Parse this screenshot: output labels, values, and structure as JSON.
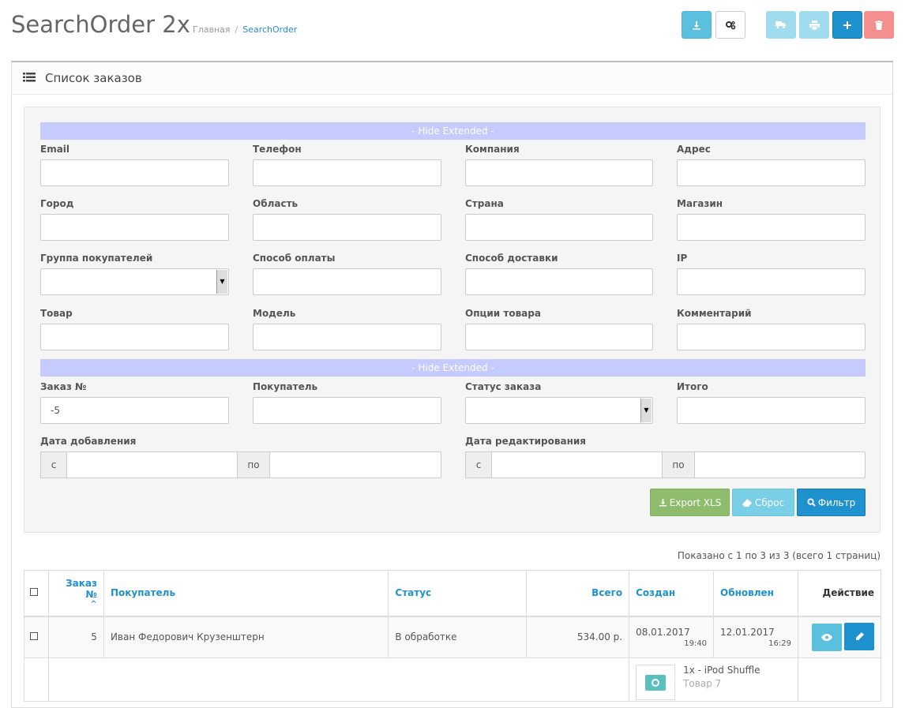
{
  "header": {
    "title": "SearchOrder 2x",
    "breadcrumb": [
      "Главная",
      "SearchOrder"
    ],
    "breadcrumb_sep": "/",
    "toolbar": {
      "download_icon": "download-icon",
      "settings_icon": "cogs-icon",
      "shipping_icon": "truck-icon",
      "print_icon": "print-icon",
      "add_icon": "plus-icon",
      "delete_icon": "trash-icon"
    }
  },
  "panel": {
    "title": "Список заказов",
    "title_icon": "list-icon"
  },
  "filters": {
    "extended_toggle_1": "- Hide Extended -",
    "extended_toggle_2": "- Hide Extended -",
    "fields": {
      "email": {
        "label": "Email",
        "value": ""
      },
      "phone": {
        "label": "Телефон",
        "value": ""
      },
      "company": {
        "label": "Компания",
        "value": ""
      },
      "address": {
        "label": "Адрес",
        "value": ""
      },
      "city": {
        "label": "Город",
        "value": ""
      },
      "region": {
        "label": "Область",
        "value": ""
      },
      "country": {
        "label": "Страна",
        "value": ""
      },
      "store": {
        "label": "Магазин",
        "value": ""
      },
      "customer_group": {
        "label": "Группа покупателей",
        "value": ""
      },
      "payment_method": {
        "label": "Способ оплаты",
        "value": ""
      },
      "shipping_method": {
        "label": "Способ доставки",
        "value": ""
      },
      "ip": {
        "label": "IP",
        "value": ""
      },
      "product": {
        "label": "Товар",
        "value": ""
      },
      "model": {
        "label": "Модель",
        "value": ""
      },
      "product_options": {
        "label": "Опции товара",
        "value": ""
      },
      "comment": {
        "label": "Комментарий",
        "value": ""
      },
      "order_id": {
        "label": "Заказ №",
        "value": "-5"
      },
      "customer": {
        "label": "Покупатель",
        "value": ""
      },
      "order_status": {
        "label": "Статус заказа",
        "value": ""
      },
      "total": {
        "label": "Итого",
        "value": ""
      },
      "date_added": {
        "label": "Дата добавления",
        "from": "с",
        "to": "по"
      },
      "date_modified": {
        "label": "Дата редактирования",
        "from": "с",
        "to": "по"
      }
    },
    "buttons": {
      "export": "Export XLS",
      "reset": "Сброс",
      "filter": "Фильтр"
    }
  },
  "results": {
    "summary": "Показано с 1 по 3 из 3 (всего 1 страниц)",
    "columns": {
      "order_id": "Заказ №",
      "customer": "Покупатель",
      "status": "Статус",
      "total": "Всего",
      "created": "Создан",
      "updated": "Обновлен",
      "action": "Действие"
    },
    "rows": [
      {
        "order_id": "5",
        "customer": "Иван Федорович Крузенштерн",
        "status": "В обработке",
        "total": "534.00 р.",
        "created_date": "08.01.2017",
        "created_time": "19:40",
        "updated_date": "12.01.2017",
        "updated_time": "16:29",
        "product_line": "1x - iPod Shuffle",
        "product_sub": "Товар 7"
      }
    ]
  },
  "colors": {
    "primary": "#1e91cf",
    "info": "#5bc0de",
    "success": "#8fbb6c",
    "extended_bar": "#c5caff"
  }
}
